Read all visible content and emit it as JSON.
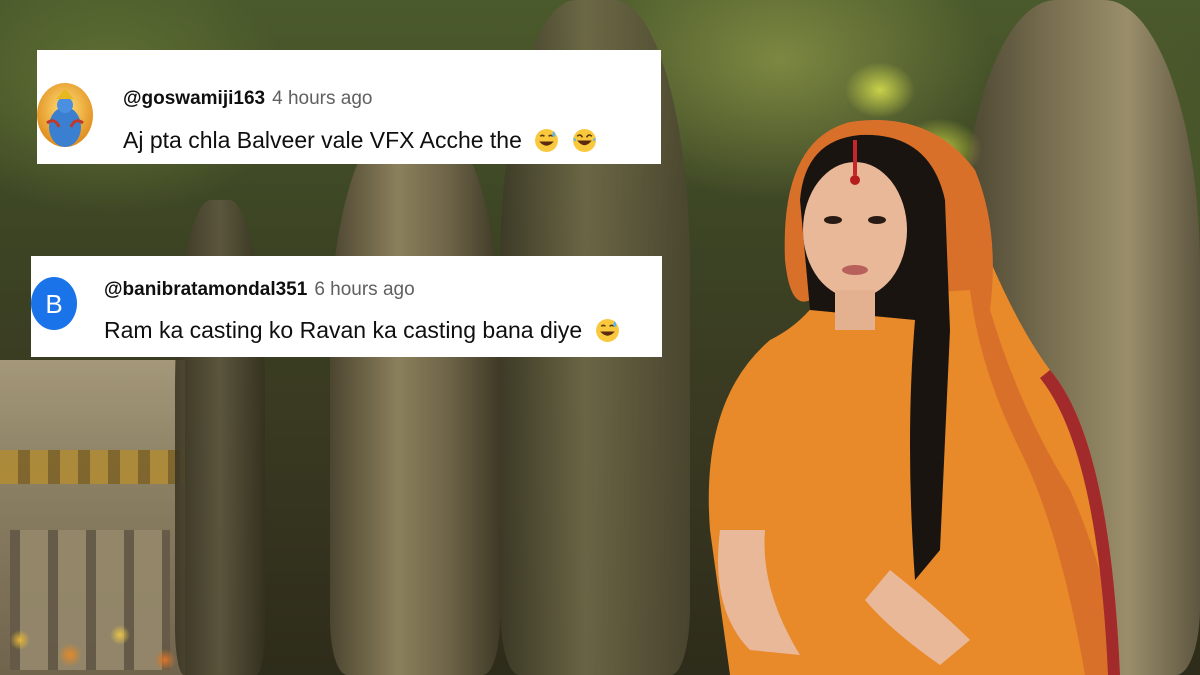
{
  "comments": [
    {
      "handle": "@goswamiji163",
      "time": "4 hours ago",
      "text": "Aj pta chla Balveer vale VFX Acche the",
      "emojis": [
        "grinning-sweat-emoji",
        "tears-of-joy-emoji"
      ],
      "avatar": "deity-picture"
    },
    {
      "handle": "@banibratamondal351",
      "time": "6 hours ago",
      "text": "Ram ka casting ko Ravan ka casting bana diye",
      "emojis": [
        "grinning-sweat-emoji"
      ],
      "avatar_letter": "B",
      "avatar_color": "#1a73e8"
    }
  ],
  "colors": {
    "card_bg": "#ffffff",
    "handle": "#0f0f0f",
    "timestamp": "#606060",
    "saree": "#e8892a"
  }
}
